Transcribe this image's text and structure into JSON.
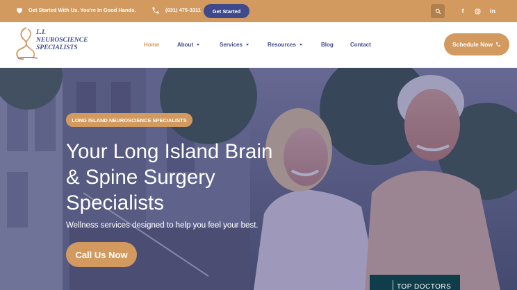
{
  "topbar": {
    "tagline": "Get Started With Us. You're In Good Hands.",
    "phone": "(631) 475-3311",
    "get_started_label": "Get Started",
    "social_icons": [
      "facebook-icon",
      "instagram-icon",
      "linkedin-icon"
    ]
  },
  "header": {
    "logo_lines": [
      "L.I.",
      "NEUROSCIENCE",
      "SPECIALISTS"
    ],
    "nav": [
      {
        "label": "Home",
        "active": true,
        "dropdown": false
      },
      {
        "label": "About",
        "active": false,
        "dropdown": true
      },
      {
        "label": "Services",
        "active": false,
        "dropdown": true
      },
      {
        "label": "Resources",
        "active": false,
        "dropdown": true
      },
      {
        "label": "Blog",
        "active": false,
        "dropdown": false
      },
      {
        "label": "Contact",
        "active": false,
        "dropdown": false
      }
    ],
    "schedule_label": "Schedule Now"
  },
  "hero": {
    "badge": "LONG ISLAND NEUROSCIENCE SPECIALISTS",
    "title_lines": [
      "Your Long Island Brain",
      "& Spine Surgery",
      "Specialists"
    ],
    "subtitle": "Wellness services designed to help you feel your best.",
    "cta_label": "Call Us Now",
    "award_text": "TOP DOCTORS"
  },
  "colors": {
    "accent": "#d39a5f",
    "brand": "#3f4a8c",
    "topdoc_bg": "#0f3d4a"
  }
}
